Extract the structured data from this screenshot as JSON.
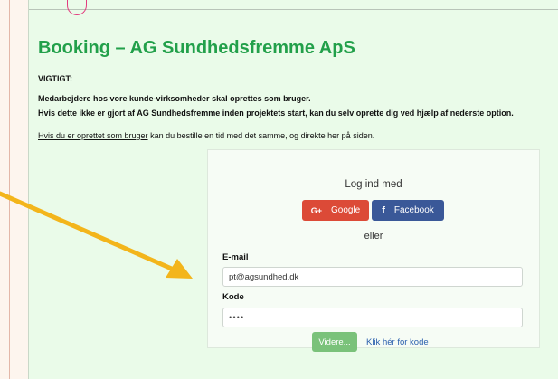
{
  "page": {
    "title": "Booking – AG Sundhedsfremme ApS",
    "important_label": "VIGTIGT:",
    "notice_line1": "Medarbejdere hos vore kunde-virksomheder skal oprettes som bruger.",
    "notice_line2": "Hvis dette ikke er gjort af AG Sundhedsfremme inden projektets start, kan du selv oprette dig ved hjælp af nederste option.",
    "registered_link": "Hvis du er oprettet som bruger",
    "registered_rest": " kan du bestille en tid med det samme, og direkte her på siden."
  },
  "login": {
    "heading": "Log ind med",
    "google_icon": "G+",
    "google_label": "Google",
    "facebook_icon": "f",
    "facebook_label": "Facebook",
    "or_label": "eller",
    "email_label": "E-mail",
    "email_value": "pt@agsundhed.dk",
    "password_label": "Kode",
    "password_value": "••••",
    "submit_label": "Videre...",
    "code_link": "Klik hér for kode"
  },
  "colors": {
    "title": "#22a04a",
    "google": "#dc4a37",
    "facebook": "#3a5898",
    "submit": "#7ac27a",
    "arrow": "#f3b51b"
  }
}
